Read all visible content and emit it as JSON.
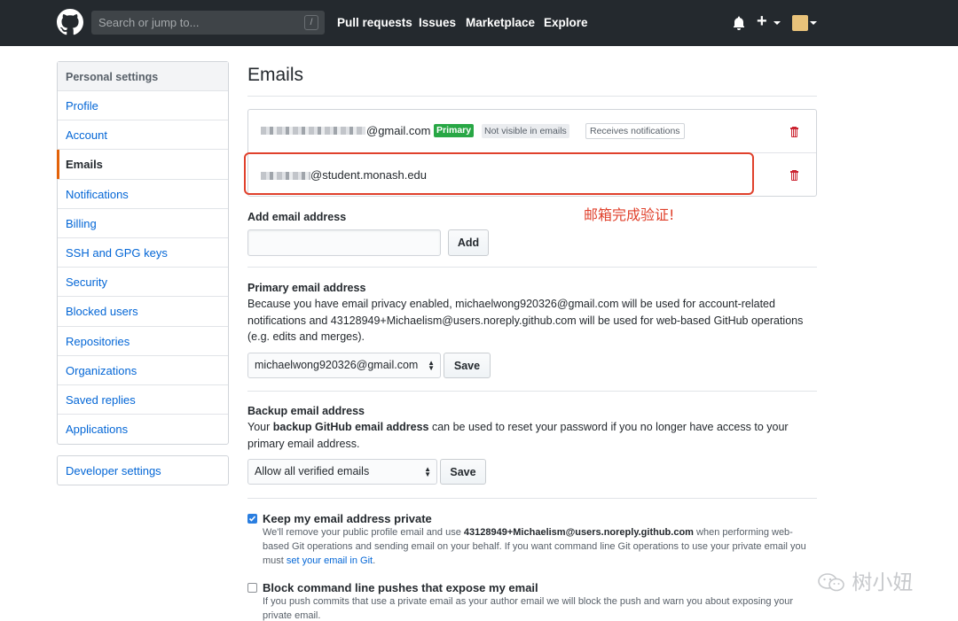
{
  "header": {
    "search_placeholder": "Search or jump to...",
    "search_shortcut": "/",
    "nav": [
      "Pull requests",
      "Issues",
      "Marketplace",
      "Explore"
    ]
  },
  "sidebar": {
    "heading": "Personal settings",
    "items": [
      {
        "label": "Profile"
      },
      {
        "label": "Account"
      },
      {
        "label": "Emails",
        "active": true
      },
      {
        "label": "Notifications"
      },
      {
        "label": "Billing"
      },
      {
        "label": "SSH and GPG keys"
      },
      {
        "label": "Security"
      },
      {
        "label": "Blocked users"
      },
      {
        "label": "Repositories"
      },
      {
        "label": "Organizations"
      },
      {
        "label": "Saved replies"
      },
      {
        "label": "Applications"
      }
    ],
    "developer_settings": "Developer settings"
  },
  "main": {
    "title": "Emails",
    "emails": [
      {
        "address_suffix": "@gmail.com",
        "badge_primary": "Primary",
        "badge_visibility": "Not visible in emails",
        "badge_notify": "Receives notifications"
      },
      {
        "address_suffix": "@student.monash.edu"
      }
    ],
    "annotation": "邮箱完成验证!",
    "add_email": {
      "label": "Add email address",
      "input_value": "",
      "button": "Add"
    },
    "primary": {
      "label": "Primary email address",
      "description_lines": [
        "Because you have email privacy enabled, michaelwong920326@gmail.com will be used for account-related",
        "notifications and 43128949+Michaelism@users.noreply.github.com will be used for web-based GitHub operations",
        "(e.g. edits and merges)."
      ],
      "select_value": "michaelwong920326@gmail.com",
      "button": "Save"
    },
    "backup": {
      "label": "Backup email address",
      "desc_1": "Your ",
      "desc_bold": "backup GitHub email address",
      "desc_2": " can be used to reset your password if you no longer have access to your",
      "desc_line2": "primary email address.",
      "select_value": "Allow all verified emails",
      "button": "Save"
    },
    "keep_private": {
      "checked": true,
      "label": "Keep my email address private",
      "l1a": "We'll remove your public profile email and use ",
      "l1b": "43128949+Michaelism@users.noreply.github.com",
      "l1c": " when performing web-",
      "l2": "based Git operations and sending email on your behalf. If you want command line Git operations to use your private email you",
      "l3a": "must ",
      "l3link": "set your email in Git",
      "l3b": "."
    },
    "block_push": {
      "checked": false,
      "label": "Block command line pushes that expose my email",
      "l1": "If you push commits that use a private email as your author email we will block the push and warn you about exposing your",
      "l2": "private email."
    }
  },
  "watermark": "树小妞",
  "colors": {
    "header_bg": "#24292e",
    "link": "#0366d6",
    "primary_badge": "#28a745",
    "annotation": "#e0412c",
    "active_marker": "#e36209"
  }
}
